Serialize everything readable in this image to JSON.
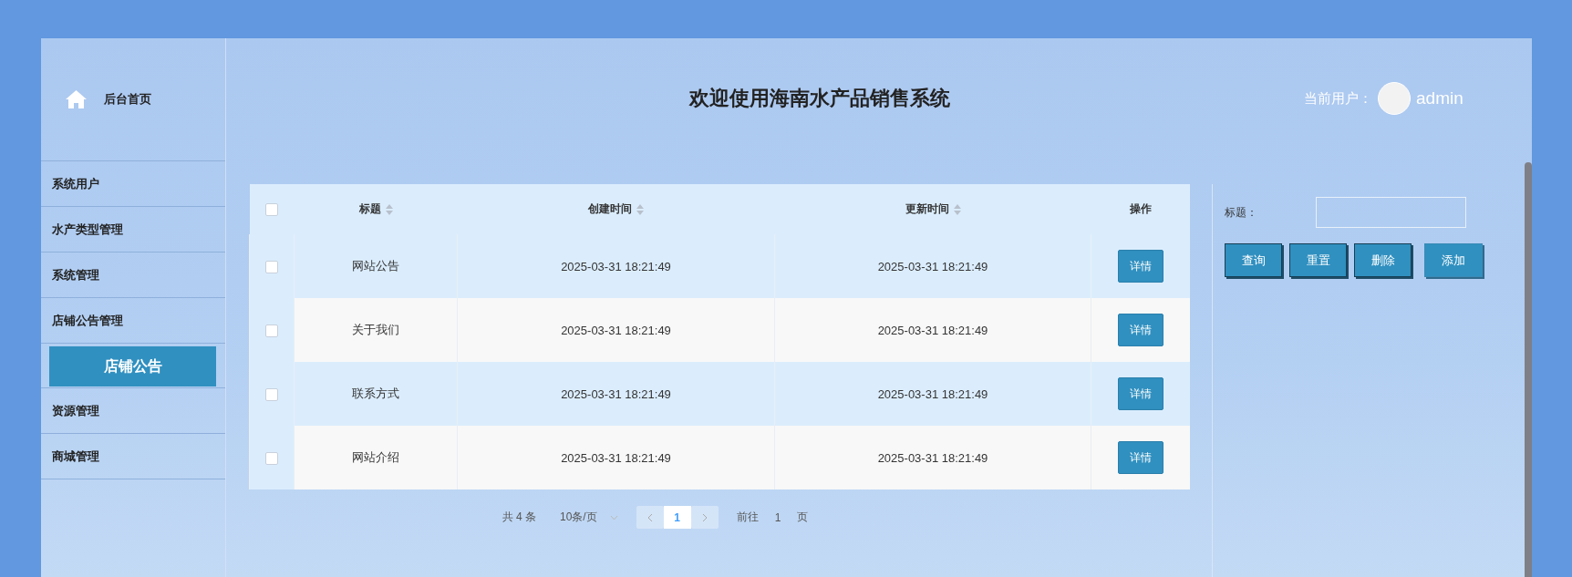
{
  "sidebar": {
    "home": {
      "label": "后台首页"
    },
    "items": [
      {
        "label": "系统用户"
      },
      {
        "label": "水产类型管理"
      },
      {
        "label": "系统管理"
      },
      {
        "label": "店铺公告管理",
        "children": [
          {
            "label": "店铺公告",
            "selected": true
          }
        ]
      },
      {
        "label": "资源管理"
      },
      {
        "label": "商城管理"
      }
    ]
  },
  "header": {
    "title": "欢迎使用海南水产品销售系统",
    "user_label": "当前用户：",
    "username": "admin"
  },
  "table": {
    "select_all": {
      "checked": false
    },
    "columns": [
      {
        "label": "标题",
        "sortable": true
      },
      {
        "label": "创建时间",
        "sortable": true
      },
      {
        "label": "更新时间",
        "sortable": true
      },
      {
        "label": "操作",
        "sortable": false
      }
    ],
    "rows": [
      {
        "checked": false,
        "title": "网站公告",
        "created": "2025-03-31 18:21:49",
        "updated": "2025-03-31 18:21:49",
        "action": "详情"
      },
      {
        "checked": false,
        "title": "关于我们",
        "created": "2025-03-31 18:21:49",
        "updated": "2025-03-31 18:21:49",
        "action": "详情"
      },
      {
        "checked": false,
        "title": "联系方式",
        "created": "2025-03-31 18:21:49",
        "updated": "2025-03-31 18:21:49",
        "action": "详情"
      },
      {
        "checked": false,
        "title": "网站介绍",
        "created": "2025-03-31 18:21:49",
        "updated": "2025-03-31 18:21:49",
        "action": "详情"
      }
    ]
  },
  "pagination": {
    "total": "共 4 条",
    "page_size": "10条/页",
    "pages": [
      {
        "label": "1",
        "selected": true
      }
    ],
    "goto_label": "前往",
    "goto_value": "1",
    "goto_suffix": "页"
  },
  "search": {
    "label": "标题：",
    "buttons": [
      {
        "label": "查询",
        "hovered": false
      },
      {
        "label": "重置",
        "hovered": false
      },
      {
        "label": "删除",
        "hovered": false
      },
      {
        "label": "添加",
        "hovered": true
      }
    ]
  }
}
